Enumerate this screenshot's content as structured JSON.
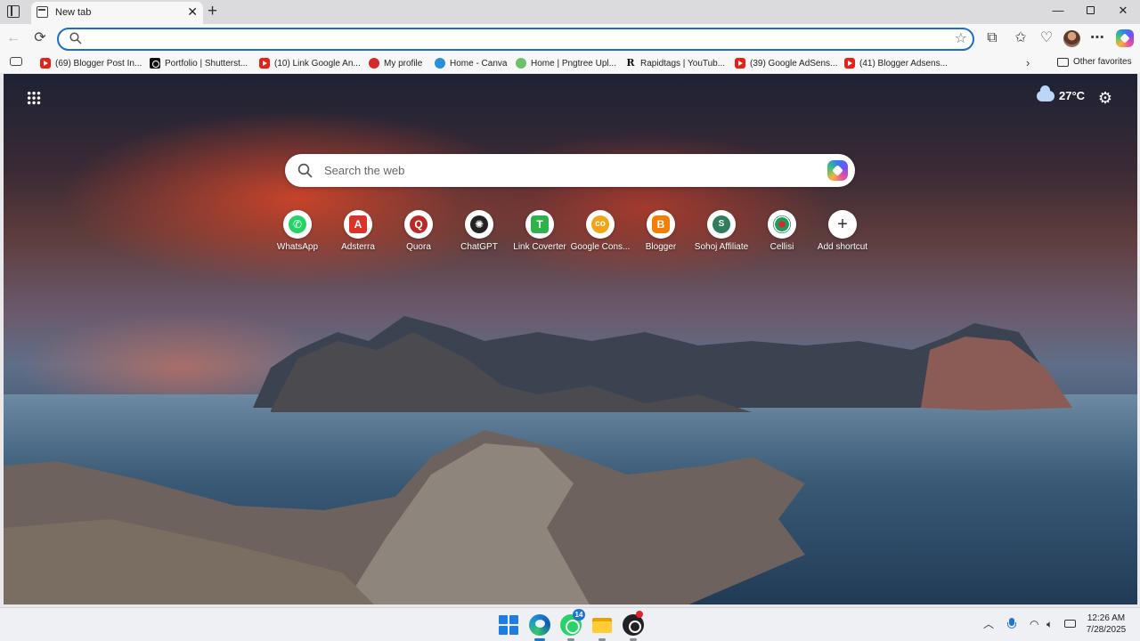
{
  "tab": {
    "title": "New tab"
  },
  "address_bar": {
    "value": "",
    "placeholder": ""
  },
  "bookmarks": [
    {
      "label": "(69) Blogger Post In...",
      "icon": "youtube-icon"
    },
    {
      "label": "Portfolio | Shutterst...",
      "icon": "shutterstock-icon"
    },
    {
      "label": "(10) Link Google An...",
      "icon": "youtube-icon"
    },
    {
      "label": "My profile",
      "icon": "profile-icon"
    },
    {
      "label": "Home - Canva",
      "icon": "canva-icon"
    },
    {
      "label": "Home | Pngtree Upl...",
      "icon": "pngtree-icon"
    },
    {
      "label": "Rapidtags | YouTub...",
      "icon": "rapidtags-icon"
    },
    {
      "label": "(39) Google AdSens...",
      "icon": "youtube-icon"
    },
    {
      "label": "(41) Blogger Adsens...",
      "icon": "youtube-icon"
    }
  ],
  "other_favorites": "Other favorites",
  "weather": {
    "temp": "27°C",
    "icon": "cloud-icon"
  },
  "search": {
    "placeholder": "Search the web"
  },
  "shortcuts": [
    {
      "label": "WhatsApp",
      "icon": "whatsapp-icon",
      "color": "#25d366"
    },
    {
      "label": "Adsterra",
      "icon": "adsterra-icon",
      "color": "#d9342b"
    },
    {
      "label": "Quora",
      "icon": "quora-icon",
      "color": "#b92b27"
    },
    {
      "label": "ChatGPT",
      "icon": "chatgpt-icon",
      "color": "#222222"
    },
    {
      "label": "Link Coverter",
      "icon": "link-coverter-icon",
      "color": "#2db34a"
    },
    {
      "label": "Google Cons...",
      "icon": "google-console-icon",
      "color": "#f2a516"
    },
    {
      "label": "Blogger",
      "icon": "blogger-icon",
      "color": "#f57d00"
    },
    {
      "label": "Sohoj Affiliate",
      "icon": "sohoj-affiliate-icon",
      "color": "#2e7d5b"
    },
    {
      "label": "Cellisi",
      "icon": "cellisi-icon",
      "color": "#1e9a5a"
    },
    {
      "label": "Add shortcut",
      "icon": "plus-icon",
      "color": "#333333"
    }
  ],
  "taskbar": {
    "whatsapp_badge": "14",
    "time": "12:26 AM",
    "date": "7/28/2025"
  },
  "colors": {
    "accent": "#1b6fc9"
  }
}
